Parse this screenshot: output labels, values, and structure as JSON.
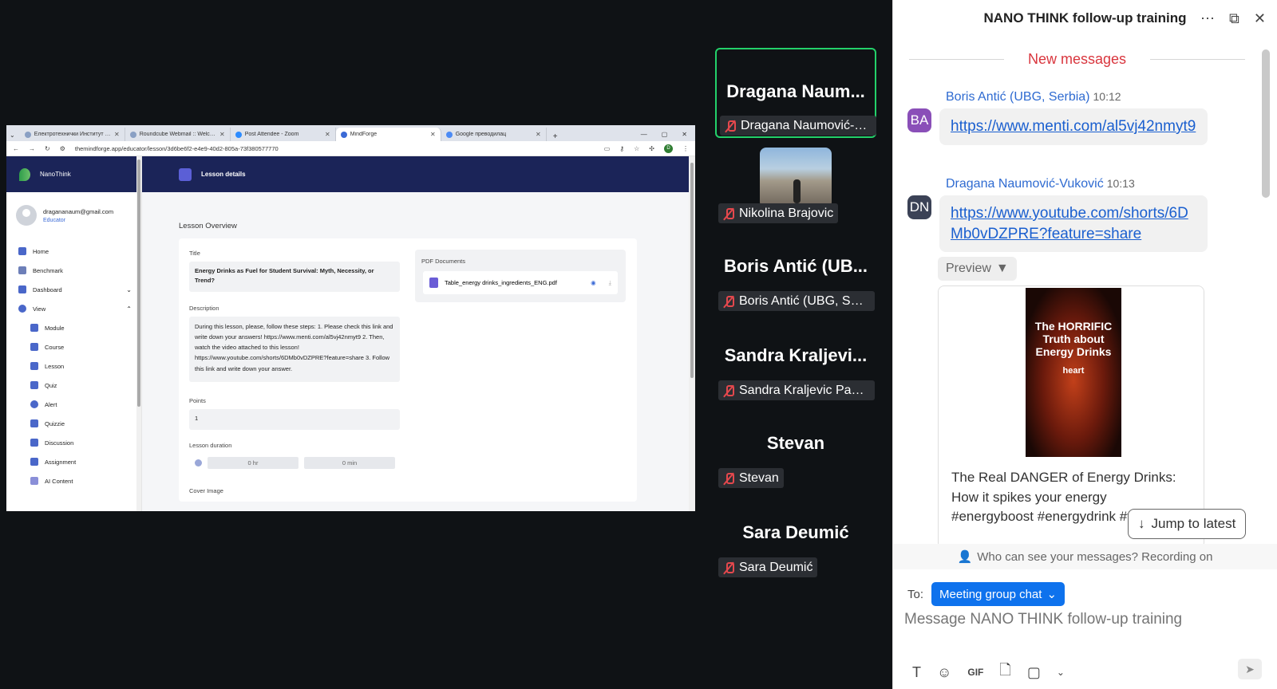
{
  "browser": {
    "tabs": [
      {
        "title": "Електротехнички Институт Нико",
        "active": false
      },
      {
        "title": "Roundcube Webmail :: Welcome",
        "active": false
      },
      {
        "title": "Post Attendee - Zoom",
        "active": false
      },
      {
        "title": "MindForge",
        "active": true
      },
      {
        "title": "Google преводилац",
        "active": false
      }
    ],
    "url": "themindforge.app/educator/lesson/3d6be6f2-e4e9-40d2-805a-73f380577770",
    "profile_initial": "D"
  },
  "app": {
    "brand": "NanoThink",
    "user_email": "dragananaum@gmail.com",
    "user_role": "Educator",
    "nav": [
      {
        "label": "Home",
        "sub": false,
        "chevron": ""
      },
      {
        "label": "Benchmark",
        "sub": false,
        "chevron": ""
      },
      {
        "label": "Dashboard",
        "sub": false,
        "chevron": "⌄"
      },
      {
        "label": "View",
        "sub": false,
        "chevron": "⌃"
      },
      {
        "label": "Module",
        "sub": true,
        "chevron": ""
      },
      {
        "label": "Course",
        "sub": true,
        "chevron": ""
      },
      {
        "label": "Lesson",
        "sub": true,
        "chevron": ""
      },
      {
        "label": "Quiz",
        "sub": true,
        "chevron": ""
      },
      {
        "label": "Alert",
        "sub": true,
        "chevron": ""
      },
      {
        "label": "Quizzie",
        "sub": true,
        "chevron": ""
      },
      {
        "label": "Discussion",
        "sub": true,
        "chevron": ""
      },
      {
        "label": "Assignment",
        "sub": true,
        "chevron": ""
      },
      {
        "label": "AI Content",
        "sub": true,
        "chevron": ""
      }
    ],
    "page_header": "Lesson details",
    "overview_title": "Lesson Overview",
    "title_label": "Title",
    "title_value": "Energy Drinks as Fuel for Student Survival: Myth, Necessity, or Trend?",
    "description_label": "Description",
    "description_value": "During this lesson, please, follow these steps: 1. Please check this link and write down your answers! https://www.menti.com/al5vj42nmyt9 2. Then, watch the video attached to this lesson! https://www.youtube.com/shorts/6DMb0vDZPRE?feature=share 3. Follow this link and write down your answer.",
    "points_label": "Points",
    "points_value": "1",
    "duration_label": "Lesson duration",
    "duration_hr": "0 hr",
    "duration_min": "0 min",
    "cover_label": "Cover Image",
    "pdf_label": "PDF Documents",
    "pdf_file": "Table_energy drinks_ingredients_ENG.pdf"
  },
  "participants": [
    {
      "display": "Dragana  Naum...",
      "tag": "Dragana Naumović-V...",
      "video": false,
      "active": true
    },
    {
      "display": "",
      "tag": "Nikolina Brajovic",
      "video": true,
      "active": false
    },
    {
      "display": "Boris  Antić  (UB...",
      "tag": "Boris Antić (UBG, Serbi...",
      "video": false,
      "active": false
    },
    {
      "display": "Sandra  Kraljevi...",
      "tag": "Sandra Kraljevic Pavelic",
      "video": false,
      "active": false
    },
    {
      "display": "Stevan",
      "tag": "Stevan",
      "video": false,
      "active": false
    },
    {
      "display": "Sara Deumić",
      "tag": "Sara Deumić",
      "video": false,
      "active": false
    }
  ],
  "chat": {
    "title": "NANO THINK follow-up training",
    "new_messages": "New messages",
    "messages": [
      {
        "initials": "BA",
        "sender": "Boris Antić (UBG, Serbia)",
        "time": "10:12",
        "text": "https://www.menti.com/al5vj42nmyt9",
        "avatar_color": "#8a4fb8"
      },
      {
        "initials": "DN",
        "sender": "Dragana Naumović-Vuković",
        "time": "10:13",
        "text": "https://www.youtube.com/shorts/6DMb0vDZPRE?feature=share",
        "avatar_color": "#3b4256"
      }
    ],
    "preview_label": "Preview",
    "preview_thumb_title": "The HORRIFIC Truth about Energy Drinks",
    "preview_thumb_sub": "heart",
    "preview_text": "The Real DANGER of Energy Drinks: How it spikes your energy #energyboost #energydrink #facts",
    "jump_label": "Jump to latest",
    "visibility_note": "Who can see your messages? Recording on",
    "to_label": "To:",
    "recipient": "Meeting group chat",
    "composer_placeholder": "Message NANO THINK follow-up training"
  },
  "colors": {
    "accent_blue": "#0e72ed",
    "active_speaker": "#23d16a",
    "muted_red": "#e5484d",
    "app_navy": "#1b2458"
  }
}
